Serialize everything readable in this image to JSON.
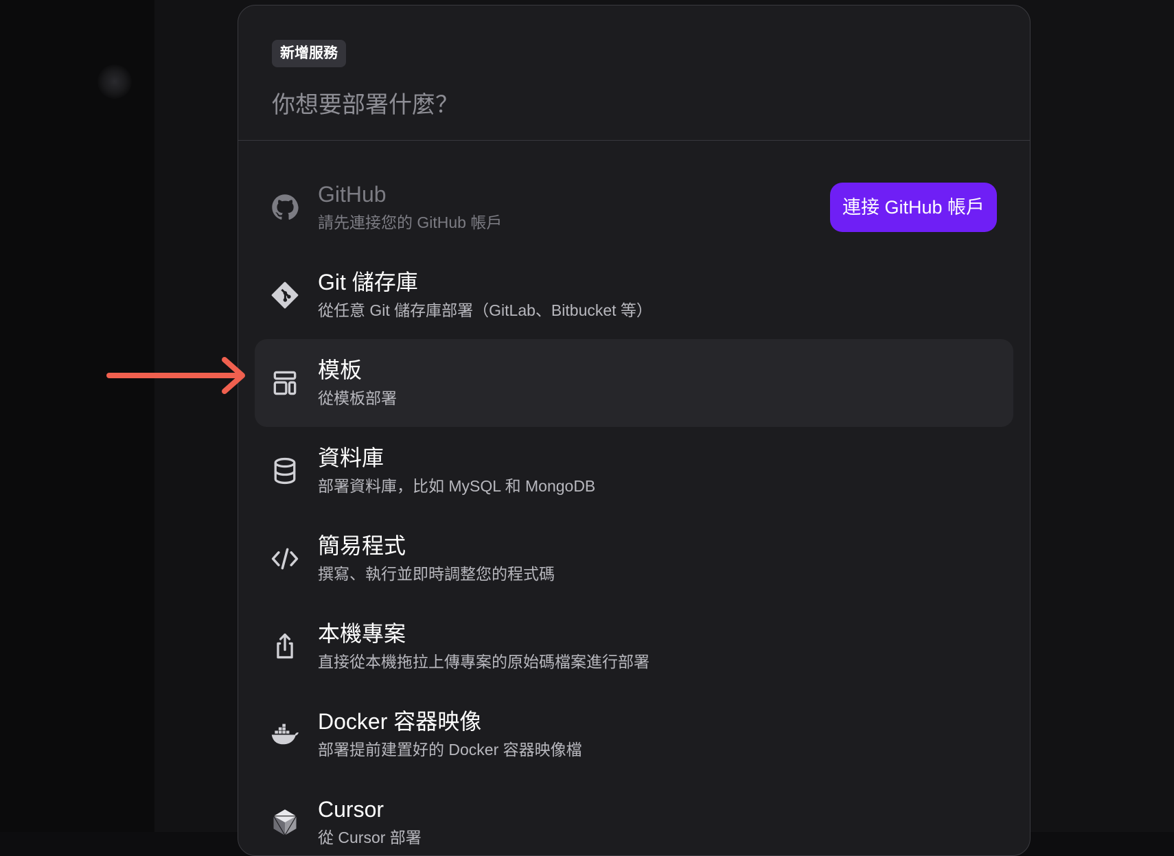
{
  "header": {
    "tag_label": "新增服務",
    "prompt": "你想要部署什麼？"
  },
  "colors": {
    "accent": "#6f1ff5",
    "annotation_arrow": "#f0604f",
    "modal_bg": "#1c1c1f",
    "highlight_bg": "#26262a"
  },
  "services": [
    {
      "title": "GitHub",
      "desc": "請先連接您的 GitHub 帳戶",
      "icon": "github-icon",
      "disabled": true
    },
    {
      "title": "Git 儲存庫",
      "desc": "從任意 Git 儲存庫部署（GitLab、Bitbucket 等）",
      "icon": "git-icon"
    },
    {
      "title": "模板",
      "desc": "從模板部署",
      "icon": "template-icon",
      "highlighted": true
    },
    {
      "title": "資料庫",
      "desc": "部署資料庫，比如 MySQL 和 MongoDB",
      "icon": "database-icon"
    },
    {
      "title": "簡易程式",
      "desc": "撰寫、執行並即時調整您的程式碼",
      "icon": "code-icon"
    },
    {
      "title": "本機專案",
      "desc": "直接從本機拖拉上傳專案的原始碼檔案進行部署",
      "icon": "upload-icon"
    },
    {
      "title": "Docker 容器映像",
      "desc": "部署提前建置好的 Docker 容器映像檔",
      "icon": "docker-icon"
    },
    {
      "title": "Cursor",
      "desc": "從 Cursor 部署",
      "icon": "cursor-icon"
    }
  ],
  "github_connect_label": "連接 GitHub 帳戶"
}
